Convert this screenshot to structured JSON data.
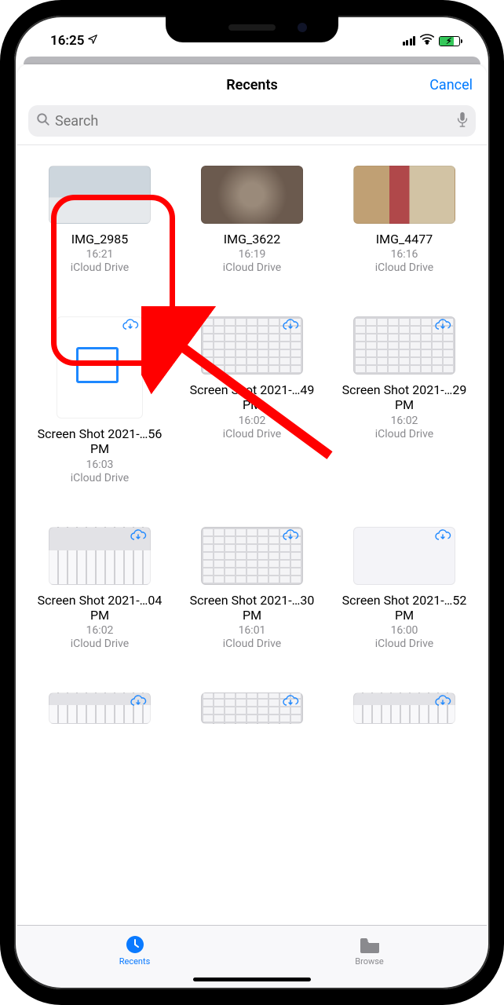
{
  "status": {
    "time": "16:25",
    "location_icon": "location-arrow-icon",
    "signal_icon": "signal-icon",
    "wifi_icon": "wifi-icon",
    "battery_icon": "battery-charging-icon"
  },
  "header": {
    "title": "Recents",
    "cancel": "Cancel"
  },
  "search": {
    "placeholder": "Search",
    "search_icon": "magnifier-icon",
    "mic_icon": "microphone-icon"
  },
  "cloud_icon": "cloud-download-icon",
  "files": [
    {
      "name": "IMG_2985",
      "time": "16:21",
      "location": "iCloud Drive",
      "kind": "photo-beach",
      "cloud": false
    },
    {
      "name": "IMG_3622",
      "time": "16:19",
      "location": "iCloud Drive",
      "kind": "photo-dog",
      "cloud": false
    },
    {
      "name": "IMG_4477",
      "time": "16:16",
      "location": "iCloud Drive",
      "kind": "photo-person",
      "cloud": false
    },
    {
      "name": "Screen Shot 2021-…56 PM",
      "time": "16:03",
      "location": "iCloud Drive",
      "kind": "doc",
      "cloud": true
    },
    {
      "name": "Screen Shot 2021-…49 PM",
      "time": "16:02",
      "location": "iCloud Drive",
      "kind": "screenshot",
      "cloud": true
    },
    {
      "name": "Screen Shot 2021-…29 PM",
      "time": "16:02",
      "location": "iCloud Drive",
      "kind": "screenshot",
      "cloud": true
    },
    {
      "name": "Screen Shot 2021-…04 PM",
      "time": "16:02",
      "location": "iCloud Drive",
      "kind": "screenshot2",
      "cloud": true
    },
    {
      "name": "Screen Shot 2021-…30 PM",
      "time": "16:01",
      "location": "iCloud Drive",
      "kind": "screenshot",
      "cloud": true
    },
    {
      "name": "Screen Shot 2021-…52 PM",
      "time": "16:00",
      "location": "iCloud Drive",
      "kind": "screenshot3",
      "cloud": true
    }
  ],
  "partial_files": [
    {
      "kind": "screenshot2",
      "cloud": true
    },
    {
      "kind": "screenshot",
      "cloud": true
    },
    {
      "kind": "screenshot2",
      "cloud": true
    }
  ],
  "tabs": {
    "recents": "Recents",
    "browse": "Browse"
  },
  "annotation": {
    "highlight_target": "IMG_2985"
  }
}
